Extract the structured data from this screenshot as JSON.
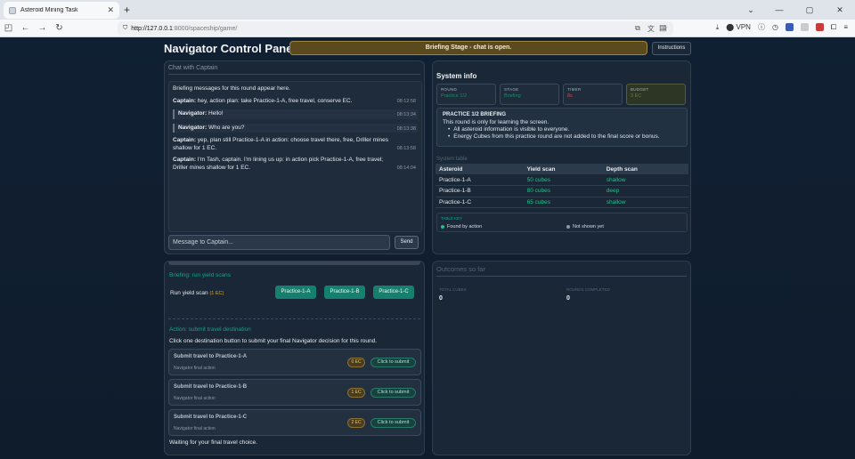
{
  "browser": {
    "tab_title": "Asteroid Mining Task",
    "url_host": "http://127.0.0.1",
    "url_path": ":8000/spaceship/game/",
    "vpn_label": "VPN"
  },
  "header": {
    "title": "Navigator Control Panel",
    "stage_banner": "Briefing Stage - chat is open.",
    "instructions_label": "Instructions"
  },
  "chat": {
    "title": "Chat with Captain",
    "intro": "Briefing messages for this round appear here.",
    "messages": [
      {
        "sender": "Captain:",
        "text": " hey, action plan: take Practice-1-A, free travel, conserve EC.",
        "time": "08:12:58"
      },
      {
        "sender": "Navigator:",
        "text": " Hello!",
        "time": "08:13:34"
      },
      {
        "sender": "Navigator:",
        "text": " Who are you?",
        "time": "08:13:38"
      },
      {
        "sender": "Captain:",
        "text": " yep, plan still Practice-1-A in action: choose travel there, free, Driller mines shallow for 1 EC.",
        "time": "08:13:58"
      },
      {
        "sender": "Captain:",
        "text": " I'm Tash, captain. I'm lining us up: in action pick Practice-1-A, free travel; Driller mines shallow for 1 EC.",
        "time": "08:14:04"
      }
    ],
    "input_placeholder": "Message to Captain...",
    "send_label": "Send"
  },
  "briefing": {
    "section_title": "Briefing: run yield scans",
    "scan_label": "Run yield scan",
    "scan_cost": "(1 EC)",
    "scan_buttons": [
      "Practice-1-A",
      "Practice-1-B",
      "Practice-1-C"
    ]
  },
  "action": {
    "section_title": "Action: submit travel destination",
    "description": "Click one destination button to submit your final Navigator decision for this round.",
    "options": [
      {
        "title": "Submit travel to Practice-1-A",
        "subtitle": "Navigator final action",
        "cost": "0 EC",
        "button": "Click to submit"
      },
      {
        "title": "Submit travel to Practice-1-B",
        "subtitle": "Navigator final action",
        "cost": "1 EC",
        "button": "Click to submit"
      },
      {
        "title": "Submit travel to Practice-1-C",
        "subtitle": "Navigator final action",
        "cost": "2 EC",
        "button": "Click to submit"
      }
    ],
    "waiting": "Waiting for your final travel choice."
  },
  "system": {
    "title": "System info",
    "stats": [
      {
        "label": "ROUND",
        "value": "Practice 1/2",
        "color": "#1f8a6a"
      },
      {
        "label": "STAGE",
        "value": "Briefing",
        "color": "#1f8a6a"
      },
      {
        "label": "TIMER",
        "value": "8s",
        "color": "#e0443a"
      },
      {
        "label": "BUDGET",
        "value": "3 EC",
        "color": "#6d7a3a"
      }
    ],
    "briefing_title": "PRACTICE 1/2 BRIEFING",
    "briefing_line": "This round is only for learning the screen.",
    "briefing_bullets": [
      "All asteroid information is visible to everyone.",
      "Energy Cubes from this practice round are not added to the final score or bonus."
    ],
    "table_caption": "System table",
    "table_headers": [
      "Asteroid",
      "Yield scan",
      "Depth scan"
    ],
    "table_rows": [
      [
        "Practice-1-A",
        "50 cubes",
        "shallow"
      ],
      [
        "Practice-1-B",
        "80 cubes",
        "deep"
      ],
      [
        "Practice-1-C",
        "65 cubes",
        "shallow"
      ]
    ],
    "legend_title": "TABLE KEY",
    "legend_found": "Found by action",
    "legend_not_shown": "Not shown yet",
    "legend_found_color": "#21c08a",
    "legend_not_color": "#8d98a6"
  },
  "outcomes": {
    "title": "Outcomes so far",
    "items": [
      {
        "label": "TOTAL CUBES",
        "value": "0"
      },
      {
        "label": "ROUNDS COMPLETED",
        "value": "0"
      }
    ]
  }
}
